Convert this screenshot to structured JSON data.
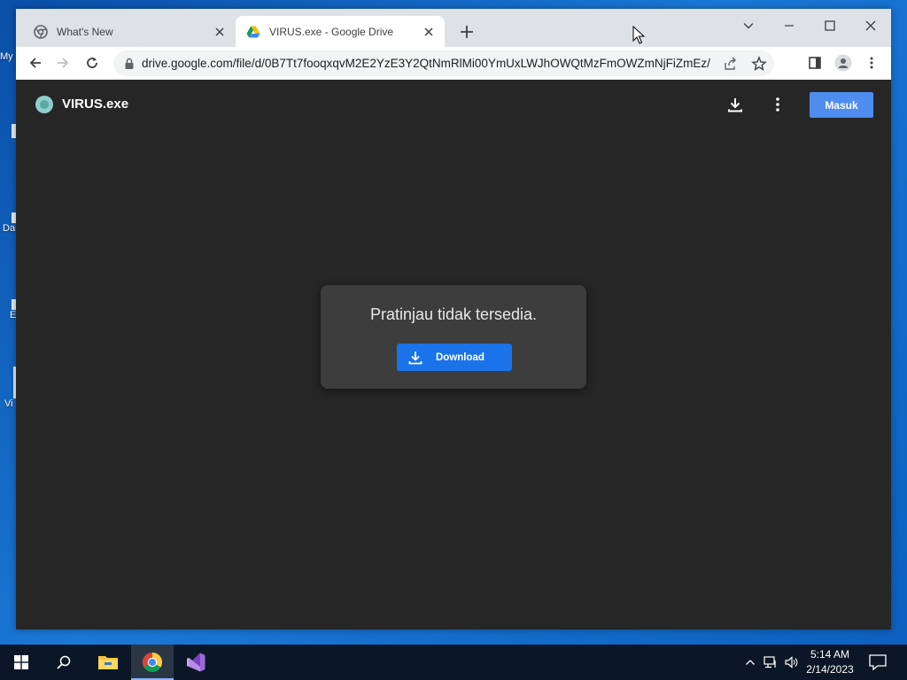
{
  "desktop": {
    "fragments": [
      "My",
      "Da",
      "E",
      "Vi"
    ]
  },
  "browser": {
    "tabs": [
      {
        "title": "What's New",
        "favicon": "chrome-icon",
        "active": false
      },
      {
        "title": "VIRUS.exe - Google Drive",
        "favicon": "google-drive-icon",
        "active": true
      }
    ],
    "address_bar": {
      "url": "drive.google.com/file/d/0B7Tt7fooqxqvM2E2YzE3Y2QtNmRlMi00YmUxLWJhOWQtMzFmOWZmNjFiZmEz/v..."
    }
  },
  "drive": {
    "file_name": "VIRUS.exe",
    "sign_in_label": "Masuk",
    "no_preview_message": "Pratinjau tidak tersedia.",
    "download_label": "Download"
  },
  "taskbar": {
    "apps": [
      "start-icon",
      "search-icon",
      "file-explorer-icon",
      "chrome-icon",
      "visual-studio-icon"
    ],
    "time": "5:14 AM",
    "date": "2/14/2023"
  },
  "colors": {
    "desktop": "#1067c4",
    "viewer_bg": "#262626",
    "primary_button": "#1a73e8",
    "sign_in_button": "#4e8cf0",
    "taskbar": "#0b1726"
  }
}
